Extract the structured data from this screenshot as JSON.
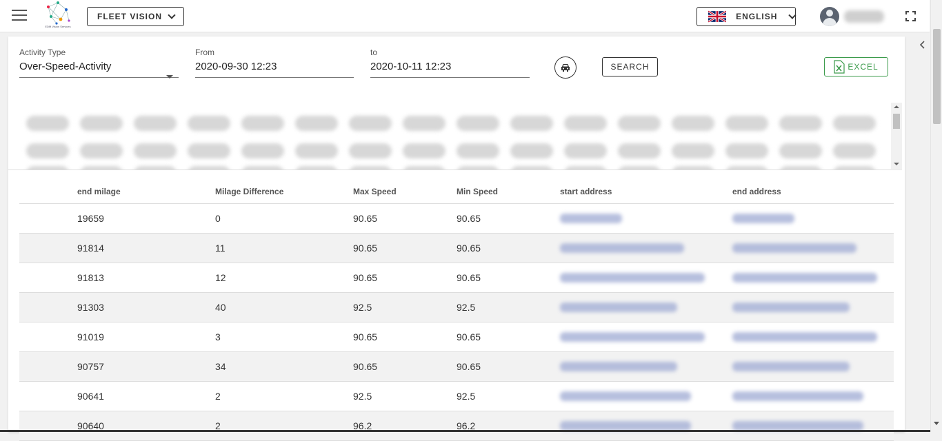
{
  "header": {
    "logo_text": "EDM Vision Services",
    "product_label": "FLEET VISION",
    "language_label": "ENGLISH"
  },
  "filters": {
    "activity_type_label": "Activity Type",
    "activity_type_value": "Over-Speed-Activity",
    "from_label": "From",
    "from_value": "2020-09-30 12:23",
    "to_label": "to",
    "to_value": "2020-10-11 12:23",
    "search_label": "SEARCH",
    "excel_label": "EXCEL"
  },
  "table": {
    "columns": [
      "end milage",
      "Milage Difference",
      "Max Speed",
      "Min Speed",
      "start address",
      "end address"
    ],
    "rows": [
      [
        "19659",
        "0",
        "90.65",
        "90.65"
      ],
      [
        "91814",
        "11",
        "90.65",
        "90.65"
      ],
      [
        "91813",
        "12",
        "90.65",
        "90.65"
      ],
      [
        "91303",
        "40",
        "92.5",
        "92.5"
      ],
      [
        "91019",
        "3",
        "90.65",
        "90.65"
      ],
      [
        "90757",
        "34",
        "90.65",
        "90.65"
      ],
      [
        "90641",
        "2",
        "92.5",
        "92.5"
      ],
      [
        "90640",
        "2",
        "96.2",
        "96.2"
      ]
    ]
  },
  "colors": {
    "excel_green": "#3a9a4a",
    "blurred_address": "#aab4d8"
  }
}
